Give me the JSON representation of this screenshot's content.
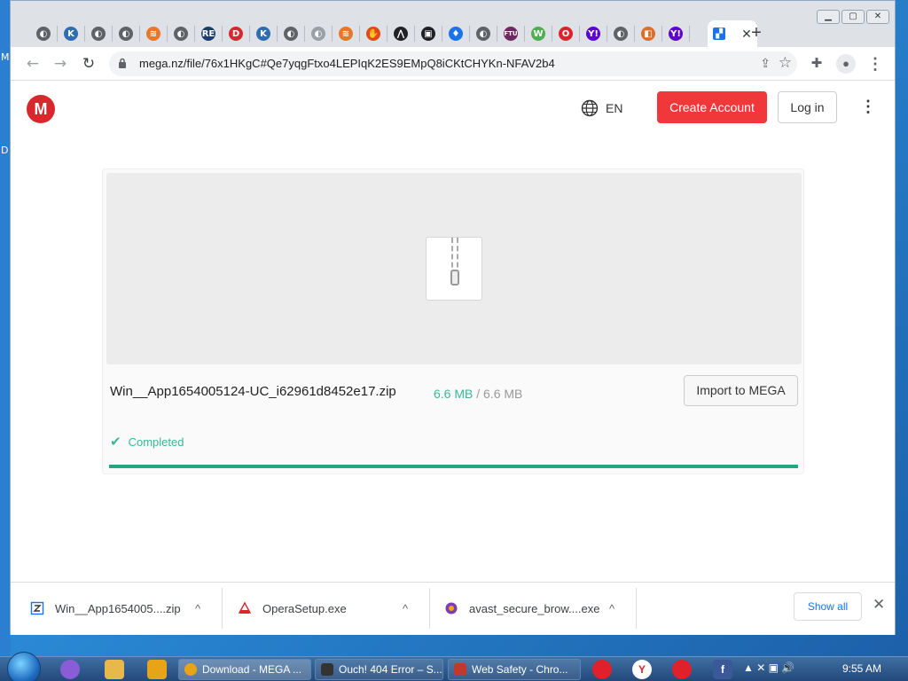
{
  "desktop": {
    "edge_letters": [
      "M",
      "D"
    ]
  },
  "tabs": {
    "favicons": [
      {
        "name": "globe-icon",
        "color": "#5f6368",
        "glyph": "◐"
      },
      {
        "name": "k-logo-icon",
        "color": "#2f6db3",
        "glyph": "K"
      },
      {
        "name": "globe-icon",
        "color": "#5f6368",
        "glyph": "◐"
      },
      {
        "name": "globe-icon",
        "color": "#5f6368",
        "glyph": "◐"
      },
      {
        "name": "layers-icon",
        "color": "#e8762b",
        "glyph": "≋"
      },
      {
        "name": "globe-icon",
        "color": "#5f6368",
        "glyph": "◐"
      },
      {
        "name": "re-logo-icon",
        "color": "#1d3c6e",
        "glyph": "RE"
      },
      {
        "name": "d-logo-icon",
        "color": "#d9272e",
        "glyph": "D"
      },
      {
        "name": "k-logo-icon",
        "color": "#2f6db3",
        "glyph": "K"
      },
      {
        "name": "globe-icon",
        "color": "#5f6368",
        "glyph": "◐"
      },
      {
        "name": "globe-icon",
        "color": "#9aa0a6",
        "glyph": "◐"
      },
      {
        "name": "layers-icon",
        "color": "#e8762b",
        "glyph": "≋"
      },
      {
        "name": "hand-icon",
        "color": "#e04a16",
        "glyph": "✋"
      },
      {
        "name": "caret-logo-icon",
        "color": "#202124",
        "glyph": "⋀"
      },
      {
        "name": "box-logo-icon",
        "color": "#202124",
        "glyph": "▣"
      },
      {
        "name": "flame-icon",
        "color": "#1a73e8",
        "glyph": "♦"
      },
      {
        "name": "globe-icon",
        "color": "#5f6368",
        "glyph": "◐"
      },
      {
        "name": "ftu-logo-icon",
        "color": "#6b2b5e",
        "glyph": "FTU"
      },
      {
        "name": "wordpress-icon",
        "color": "#4caf50",
        "glyph": "W"
      },
      {
        "name": "opera-icon",
        "color": "#e0202a",
        "glyph": "O"
      },
      {
        "name": "yahoo-icon",
        "color": "#5f01d1",
        "glyph": "Y!"
      },
      {
        "name": "globe-icon",
        "color": "#5f6368",
        "glyph": "◐"
      },
      {
        "name": "colorful-square-icon",
        "color": "#e06c2a",
        "glyph": "◧"
      },
      {
        "name": "yahoo-icon",
        "color": "#5f01d1",
        "glyph": "Y!"
      },
      {
        "name": "mega-tab-icon",
        "color": "#1a73e8",
        "glyph": "▞"
      }
    ],
    "close_glyph": "✕",
    "new_tab_glyph": "+"
  },
  "window_controls": {
    "minimize": "▁",
    "maximize": "▢",
    "close": "✕"
  },
  "toolbar": {
    "url": "mega.nz/file/76x1HKgC#Qe7yqgFtxo4LEPIqK2ES9EMpQ8iCKtCHYKn-NFAV2b4",
    "back": "←",
    "forward": "→",
    "reload": "↻",
    "share": "⇪",
    "star": "☆",
    "extensions": "✚",
    "profile": "●",
    "menu": "⋮"
  },
  "mega": {
    "logo": "M",
    "language": "EN",
    "create_account": "Create Account",
    "login": "Log in",
    "menu": "⋮",
    "file_name": "Win__App1654005124-UC_i62961d8452e17.zip",
    "downloaded": "6.6 MB",
    "size_sep": "/",
    "total": "6.6 MB",
    "import": "Import to MEGA",
    "status": "Completed",
    "status_glyph": "✔",
    "progress": 1.0
  },
  "downloads": {
    "items": [
      {
        "name": "Win__App1654005....zip",
        "icon_color": "#1a73e8"
      },
      {
        "name": "OperaSetup.exe",
        "icon_color": "#d9272e"
      },
      {
        "name": "avast_secure_brow....exe",
        "icon_color": "#7a3db8"
      }
    ],
    "caret": "^",
    "show_all": "Show all",
    "close": "✕"
  },
  "taskbar": {
    "tasks": [
      {
        "label": "Download - MEGA ...",
        "color": "#e8a317",
        "active": true
      },
      {
        "label": "Ouch! 404 Error – S...",
        "color": "#333333",
        "active": false
      },
      {
        "label": "Web Safety - Chro...",
        "color": "#c0392b",
        "active": false
      }
    ],
    "tray_glyphs": "▲ ✕ ▣ 🔊",
    "clock": "9:55 AM"
  }
}
